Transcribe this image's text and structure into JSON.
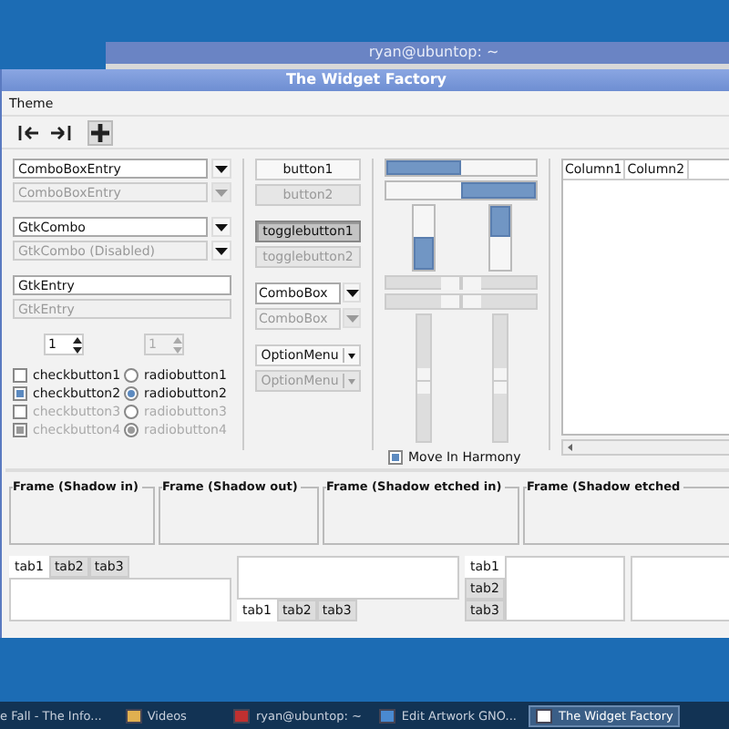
{
  "back_window": {
    "title": "ryan@ubuntop: ~"
  },
  "window": {
    "title": "The Widget Factory"
  },
  "menu": [
    "Theme"
  ],
  "toolbar": [
    {
      "kind": "first",
      "active": false
    },
    {
      "kind": "last",
      "active": false
    },
    {
      "kind": "add",
      "active": true
    }
  ],
  "entries": [
    {
      "kind": "combo_entry",
      "value": "ComboBoxEntry",
      "disabled": false
    },
    {
      "kind": "combo_entry",
      "value": "ComboBoxEntry",
      "disabled": true
    },
    {
      "kind": "combo",
      "value": "GtkCombo",
      "disabled": false
    },
    {
      "kind": "combo",
      "value": "GtkCombo (Disabled)",
      "disabled": true
    },
    {
      "kind": "entry",
      "value": "GtkEntry",
      "disabled": false
    },
    {
      "kind": "entry",
      "value": "GtkEntry",
      "disabled": true
    }
  ],
  "spins": [
    {
      "value": "1",
      "disabled": false
    },
    {
      "value": "1",
      "disabled": true
    }
  ],
  "checks": [
    {
      "label": "checkbutton1",
      "checked": false,
      "disabled": false
    },
    {
      "label": "checkbutton2",
      "checked": true,
      "disabled": false
    },
    {
      "label": "checkbutton3",
      "checked": false,
      "disabled": true
    },
    {
      "label": "checkbutton4",
      "checked": true,
      "disabled": true
    }
  ],
  "radios": [
    {
      "label": "radiobutton1",
      "selected": false,
      "disabled": false
    },
    {
      "label": "radiobutton2",
      "selected": true,
      "disabled": false
    },
    {
      "label": "radiobutton3",
      "selected": false,
      "disabled": true
    },
    {
      "label": "radiobutton4",
      "selected": true,
      "disabled": true
    }
  ],
  "buttons": [
    {
      "kind": "button",
      "label": "button1",
      "disabled": false
    },
    {
      "kind": "button",
      "label": "button2",
      "disabled": true
    },
    {
      "kind": "toggle",
      "label": "togglebutton1",
      "disabled": false,
      "on": true
    },
    {
      "kind": "toggle",
      "label": "togglebutton2",
      "disabled": true,
      "on": false
    },
    {
      "kind": "combobox",
      "label": "ComboBox",
      "disabled": false
    },
    {
      "kind": "combobox",
      "label": "ComboBox",
      "disabled": true
    },
    {
      "kind": "optionmenu",
      "label": "OptionMenu",
      "disabled": false
    },
    {
      "kind": "optionmenu",
      "label": "OptionMenu",
      "disabled": true
    }
  ],
  "hprogress": [
    {
      "level": 0.5,
      "inverted": false
    },
    {
      "level": 0.5,
      "inverted": true
    }
  ],
  "vprogress": [
    {
      "level": 0.5,
      "inverted": false
    },
    {
      "level": 0.5,
      "inverted": true
    }
  ],
  "hscales": [
    {
      "level": 0.5
    },
    {
      "level": 0.5
    }
  ],
  "vscales": [
    {
      "level": 0.45
    },
    {
      "level": 0.45
    }
  ],
  "harmony": {
    "label": "Move In Harmony",
    "checked": true
  },
  "tree": {
    "columns": [
      "Column1",
      "Column2"
    ]
  },
  "frames": [
    "Frame (Shadow in)",
    "Frame (Shadow out)",
    "Frame (Shadow etched in)",
    "Frame (Shadow etched"
  ],
  "notebooks": [
    {
      "kind": "top",
      "tabs": [
        {
          "label": "tab1",
          "selected": true
        },
        {
          "label": "tab2",
          "selected": false
        },
        {
          "label": "tab3",
          "selected": false
        }
      ]
    },
    {
      "kind": "bottom",
      "tabs": [
        {
          "label": "tab1",
          "selected": true
        },
        {
          "label": "tab2",
          "selected": false
        },
        {
          "label": "tab3",
          "selected": false
        }
      ]
    },
    {
      "kind": "left",
      "tabs": [
        {
          "label": "tab1",
          "selected": true
        },
        {
          "label": "tab2",
          "selected": false
        },
        {
          "label": "tab3",
          "selected": false
        }
      ]
    }
  ],
  "taskbar": [
    {
      "kind": "web",
      "label": "e Fall - The Info...",
      "selected": false
    },
    {
      "kind": "folder",
      "label": "Videos",
      "selected": false
    },
    {
      "kind": "terminal",
      "label": "ryan@ubuntop: ~",
      "selected": false
    },
    {
      "kind": "editor",
      "label": "Edit  Artwork GNO...",
      "selected": false
    },
    {
      "kind": "window",
      "label": "The Widget Factory",
      "selected": true
    }
  ]
}
